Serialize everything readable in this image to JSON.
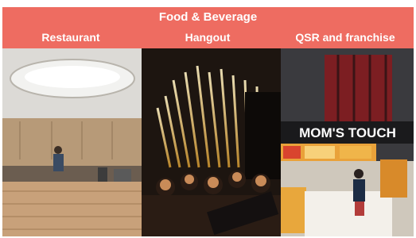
{
  "slide": {
    "title": "Food & Beverage",
    "categories": [
      {
        "label": "Restaurant"
      },
      {
        "label": "Hangout"
      },
      {
        "label": "QSR and franchise"
      }
    ],
    "sign_text": "MOM'S TOUCH"
  },
  "colors": {
    "banner": "#ee6c61",
    "text": "#ffffff"
  }
}
